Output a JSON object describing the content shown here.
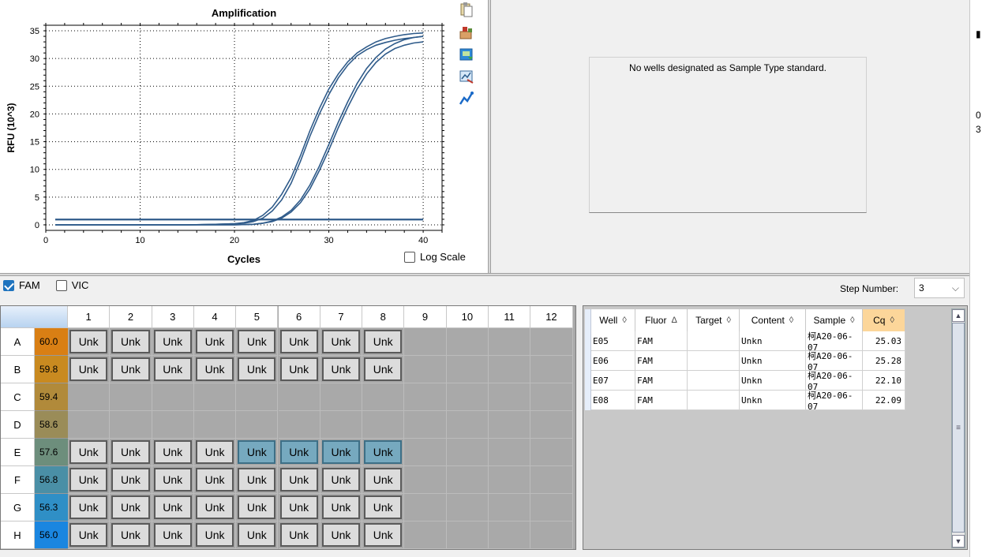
{
  "chart_data": {
    "type": "line",
    "title": "Amplification",
    "xlabel": "Cycles",
    "ylabel": "RFU (10^3)",
    "xlim": [
      0,
      42
    ],
    "ylim": [
      -1,
      36
    ],
    "xticks": [
      0,
      10,
      20,
      30,
      40
    ],
    "yticks": [
      0,
      5,
      10,
      15,
      20,
      25,
      30,
      35
    ],
    "grid": true,
    "log_scale": false,
    "line_color": "#2f5b8a",
    "series": [
      {
        "values": [
          [
            1,
            0
          ],
          [
            5,
            0
          ],
          [
            10,
            0
          ],
          [
            15,
            0
          ],
          [
            18,
            0.1
          ],
          [
            20,
            0.2
          ],
          [
            21,
            0.3
          ],
          [
            22,
            0.6
          ],
          [
            23,
            1.2
          ],
          [
            24,
            2.5
          ],
          [
            25,
            4.5
          ],
          [
            26,
            7.5
          ],
          [
            27,
            11.5
          ],
          [
            28,
            16
          ],
          [
            29,
            20
          ],
          [
            30,
            23.5
          ],
          [
            31,
            26.5
          ],
          [
            32,
            28.8
          ],
          [
            33,
            30.5
          ],
          [
            34,
            31.6
          ],
          [
            35,
            32.4
          ],
          [
            36,
            32.9
          ],
          [
            37,
            33.3
          ],
          [
            38,
            33.6
          ],
          [
            39,
            33.8
          ],
          [
            40,
            34
          ]
        ]
      },
      {
        "values": [
          [
            1,
            0
          ],
          [
            5,
            0
          ],
          [
            10,
            0
          ],
          [
            15,
            0
          ],
          [
            18,
            0.1
          ],
          [
            20,
            0.2
          ],
          [
            21,
            0.4
          ],
          [
            22,
            0.8
          ],
          [
            23,
            1.7
          ],
          [
            24,
            3.2
          ],
          [
            25,
            5.5
          ],
          [
            26,
            8.5
          ],
          [
            27,
            12.5
          ],
          [
            28,
            17
          ],
          [
            29,
            21
          ],
          [
            30,
            24.5
          ],
          [
            31,
            27.2
          ],
          [
            32,
            29.4
          ],
          [
            33,
            31
          ],
          [
            34,
            32.1
          ],
          [
            35,
            33
          ],
          [
            36,
            33.6
          ],
          [
            37,
            34
          ],
          [
            38,
            34.3
          ],
          [
            39,
            34.5
          ],
          [
            40,
            34.6
          ]
        ]
      },
      {
        "values": [
          [
            1,
            0
          ],
          [
            5,
            0
          ],
          [
            10,
            0
          ],
          [
            15,
            0
          ],
          [
            20,
            0
          ],
          [
            22,
            0.1
          ],
          [
            23,
            0.3
          ],
          [
            24,
            0.6
          ],
          [
            25,
            1.2
          ],
          [
            26,
            2.3
          ],
          [
            27,
            4
          ],
          [
            28,
            6.5
          ],
          [
            29,
            9.8
          ],
          [
            30,
            13.5
          ],
          [
            31,
            17.5
          ],
          [
            32,
            21.2
          ],
          [
            33,
            24.5
          ],
          [
            34,
            27.2
          ],
          [
            35,
            29.3
          ],
          [
            36,
            30.8
          ],
          [
            37,
            31.8
          ],
          [
            38,
            32.4
          ],
          [
            39,
            32.8
          ],
          [
            40,
            33
          ]
        ]
      },
      {
        "values": [
          [
            1,
            0
          ],
          [
            5,
            0
          ],
          [
            10,
            0
          ],
          [
            15,
            0
          ],
          [
            20,
            0
          ],
          [
            22,
            0.1
          ],
          [
            23,
            0.3
          ],
          [
            24,
            0.7
          ],
          [
            25,
            1.4
          ],
          [
            26,
            2.6
          ],
          [
            27,
            4.5
          ],
          [
            28,
            7.2
          ],
          [
            29,
            10.6
          ],
          [
            30,
            14.5
          ],
          [
            31,
            18.5
          ],
          [
            32,
            22.2
          ],
          [
            33,
            25.5
          ],
          [
            34,
            28.2
          ],
          [
            35,
            30.2
          ],
          [
            36,
            31.7
          ],
          [
            37,
            32.7
          ],
          [
            38,
            33.4
          ],
          [
            39,
            33.8
          ],
          [
            40,
            34
          ]
        ]
      },
      {
        "values": [
          [
            1,
            1
          ],
          [
            40,
            1
          ]
        ]
      },
      {
        "values": [
          [
            1,
            0.9
          ],
          [
            40,
            0.9
          ]
        ]
      }
    ]
  },
  "log_scale_label": "Log Scale",
  "toolbar_icons": [
    "copy-icon",
    "export-icon",
    "save-image-icon",
    "chart-options-icon",
    "trace-style-icon"
  ],
  "standard_curve_message": "No wells designated as Sample Type standard.",
  "right_edge_fragments": [
    "0",
    "3"
  ],
  "fluors": [
    {
      "label": "FAM",
      "checked": true
    },
    {
      "label": "VIC",
      "checked": false
    }
  ],
  "step_number": {
    "label": "Step Number:",
    "value": "3"
  },
  "plate": {
    "columns": [
      "1",
      "2",
      "3",
      "4",
      "5",
      "6",
      "7",
      "8",
      "9",
      "10",
      "11",
      "12"
    ],
    "rows": [
      "A",
      "B",
      "C",
      "D",
      "E",
      "F",
      "G",
      "H"
    ],
    "temps": [
      "60.0",
      "59.8",
      "59.4",
      "58.6",
      "57.6",
      "56.8",
      "56.3",
      "56.0"
    ],
    "temp_colors": [
      "#d97f14",
      "#c98a20",
      "#b18a3a",
      "#9a8c58",
      "#6d8e7c",
      "#4a8fa6",
      "#2f8fc6",
      "#1a86e0"
    ],
    "well_label": "Unk",
    "filled": [
      [
        1,
        1,
        1,
        1,
        1,
        1,
        1,
        1,
        0,
        0,
        0,
        0
      ],
      [
        1,
        1,
        1,
        1,
        1,
        1,
        1,
        1,
        0,
        0,
        0,
        0
      ],
      [
        0,
        0,
        0,
        0,
        0,
        0,
        0,
        0,
        0,
        0,
        0,
        0
      ],
      [
        0,
        0,
        0,
        0,
        0,
        0,
        0,
        0,
        0,
        0,
        0,
        0
      ],
      [
        1,
        1,
        1,
        1,
        1,
        1,
        1,
        1,
        0,
        0,
        0,
        0
      ],
      [
        1,
        1,
        1,
        1,
        1,
        1,
        1,
        1,
        0,
        0,
        0,
        0
      ],
      [
        1,
        1,
        1,
        1,
        1,
        1,
        1,
        1,
        0,
        0,
        0,
        0
      ],
      [
        1,
        1,
        1,
        1,
        1,
        1,
        1,
        1,
        0,
        0,
        0,
        0
      ]
    ],
    "selected": [
      [
        4,
        4
      ],
      [
        4,
        5
      ],
      [
        4,
        6
      ],
      [
        4,
        7
      ]
    ]
  },
  "table": {
    "columns": [
      {
        "label": "Well",
        "sort": "◊"
      },
      {
        "label": "Fluor",
        "sort": "Δ"
      },
      {
        "label": "Target",
        "sort": "◊"
      },
      {
        "label": "Content",
        "sort": "◊"
      },
      {
        "label": "Sample",
        "sort": "◊"
      },
      {
        "label": "Cq",
        "sort": "◊",
        "sorted": true
      }
    ],
    "rows": [
      [
        "E05",
        "FAM",
        "",
        "Unkn",
        "柯A20-06-07",
        "25.03"
      ],
      [
        "E06",
        "FAM",
        "",
        "Unkn",
        "柯A20-06-07",
        "25.28"
      ],
      [
        "E07",
        "FAM",
        "",
        "Unkn",
        "柯A20-06-07",
        "22.10"
      ],
      [
        "E08",
        "FAM",
        "",
        "Unkn",
        "柯A20-06-07",
        "22.09"
      ]
    ]
  }
}
